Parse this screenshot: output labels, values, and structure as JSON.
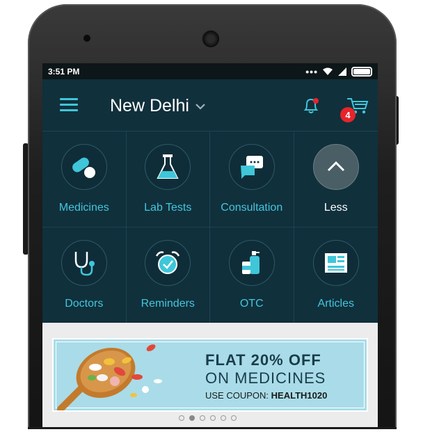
{
  "status_bar": {
    "time": "3:51 PM"
  },
  "header": {
    "city": "New Delhi",
    "cart_count": "4"
  },
  "grid": {
    "items": [
      {
        "label": "Medicines",
        "icon": "pill-icon"
      },
      {
        "label": "Lab Tests",
        "icon": "flask-icon"
      },
      {
        "label": "Consultation",
        "icon": "chat-icon"
      },
      {
        "label": "Less",
        "icon": "chevron-up-icon"
      },
      {
        "label": "Doctors",
        "icon": "stethoscope-icon"
      },
      {
        "label": "Reminders",
        "icon": "alarm-clock-icon"
      },
      {
        "label": "OTC",
        "icon": "bottle-icon"
      },
      {
        "label": "Articles",
        "icon": "newspaper-icon"
      }
    ]
  },
  "banner": {
    "line1": "FLAT 20% OFF",
    "line2": "ON MEDICINES",
    "coupon_prefix": "USE COUPON:",
    "coupon_code": "HEALTH1020",
    "page_count": 6,
    "active_page": 2
  },
  "colors": {
    "accent": "#44c6dc",
    "background": "#10303c",
    "badge": "#e5252a"
  }
}
